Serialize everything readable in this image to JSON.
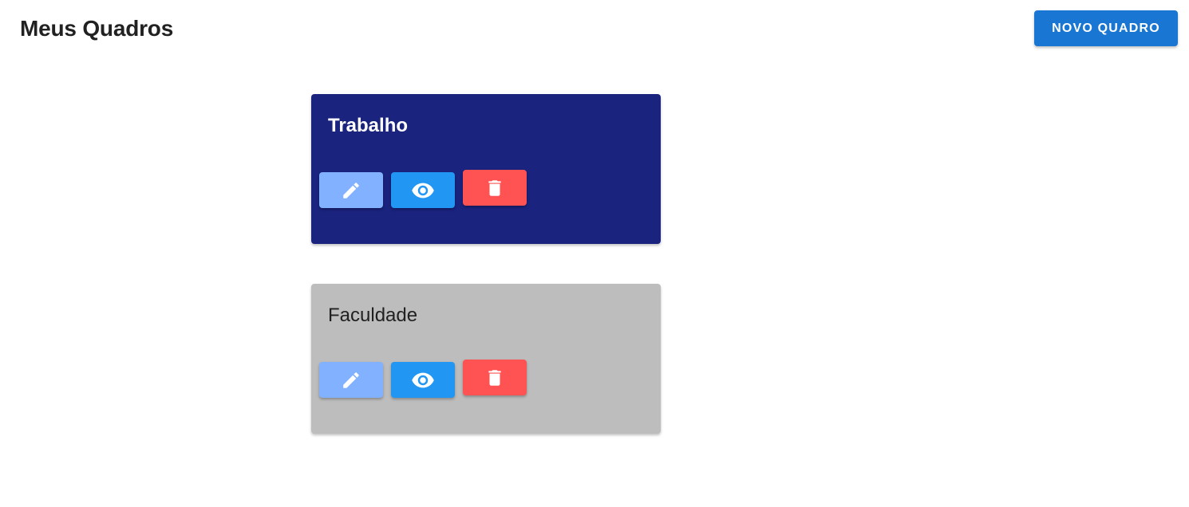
{
  "header": {
    "title": "Meus Quadros",
    "new_board_label": "NOVO QUADRO"
  },
  "colors": {
    "primary": "#1976d2",
    "edit_button": "#82b1ff",
    "view_button": "#2196f3",
    "delete_button": "#ff5252"
  },
  "boards": [
    {
      "title": "Trabalho",
      "background": "#1a237e",
      "title_color": "#ffffff",
      "actions": [
        "pencil-icon",
        "eye-icon",
        "trash-icon"
      ]
    },
    {
      "title": "Faculdade",
      "background": "#bdbdbd",
      "title_color": "#212121",
      "actions": [
        "pencil-icon",
        "eye-icon",
        "trash-icon"
      ]
    }
  ]
}
